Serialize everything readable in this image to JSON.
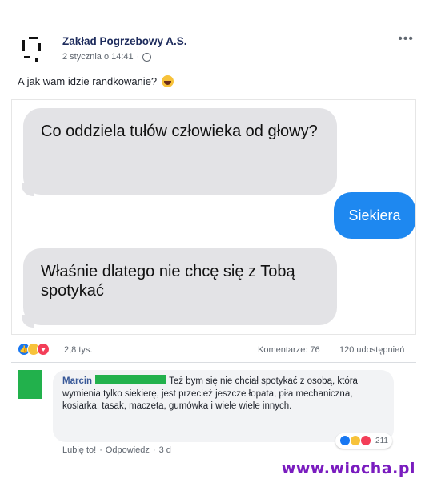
{
  "post": {
    "author": "Zakład Pogrzebowy A.S.",
    "timestamp": "2 stycznia o 14:41",
    "text": "A jak wam idzie randkowanie?",
    "more_icon": "ellipsis-icon",
    "privacy_icon": "globe-icon"
  },
  "chat": {
    "message_1": "Co oddziela tułów człowieka od głowy?",
    "reply": "Siekiera",
    "message_2": "Właśnie dlatego nie chcę się z Tobą spotykać"
  },
  "stats": {
    "reactions": "2,8 tys.",
    "comments": "Komentarze: 76",
    "shares": "120 udostępnień",
    "reaction_icons": [
      "like-icon",
      "haha-icon",
      "love-icon"
    ]
  },
  "comment": {
    "author": "Marcin",
    "text": "Też bym się nie chciał spotykać z osobą, która wymienia tylko siekierę, jest przecież jeszcze łopata, piła mechaniczna, kosiarka, tasak, maczeta, gumówka i wiele wiele innych.",
    "reaction_count": "211",
    "like_label": "Lubię to!",
    "reply_label": "Odpowiedz",
    "separator": "·",
    "age": "3 d"
  },
  "watermark": "www.wiocha.pl",
  "colors": {
    "link_blue": "#385898",
    "bubble_gray": "#e3e3e6",
    "bubble_blue": "#1e88f0",
    "watermark_purple": "#7a1cbf"
  }
}
